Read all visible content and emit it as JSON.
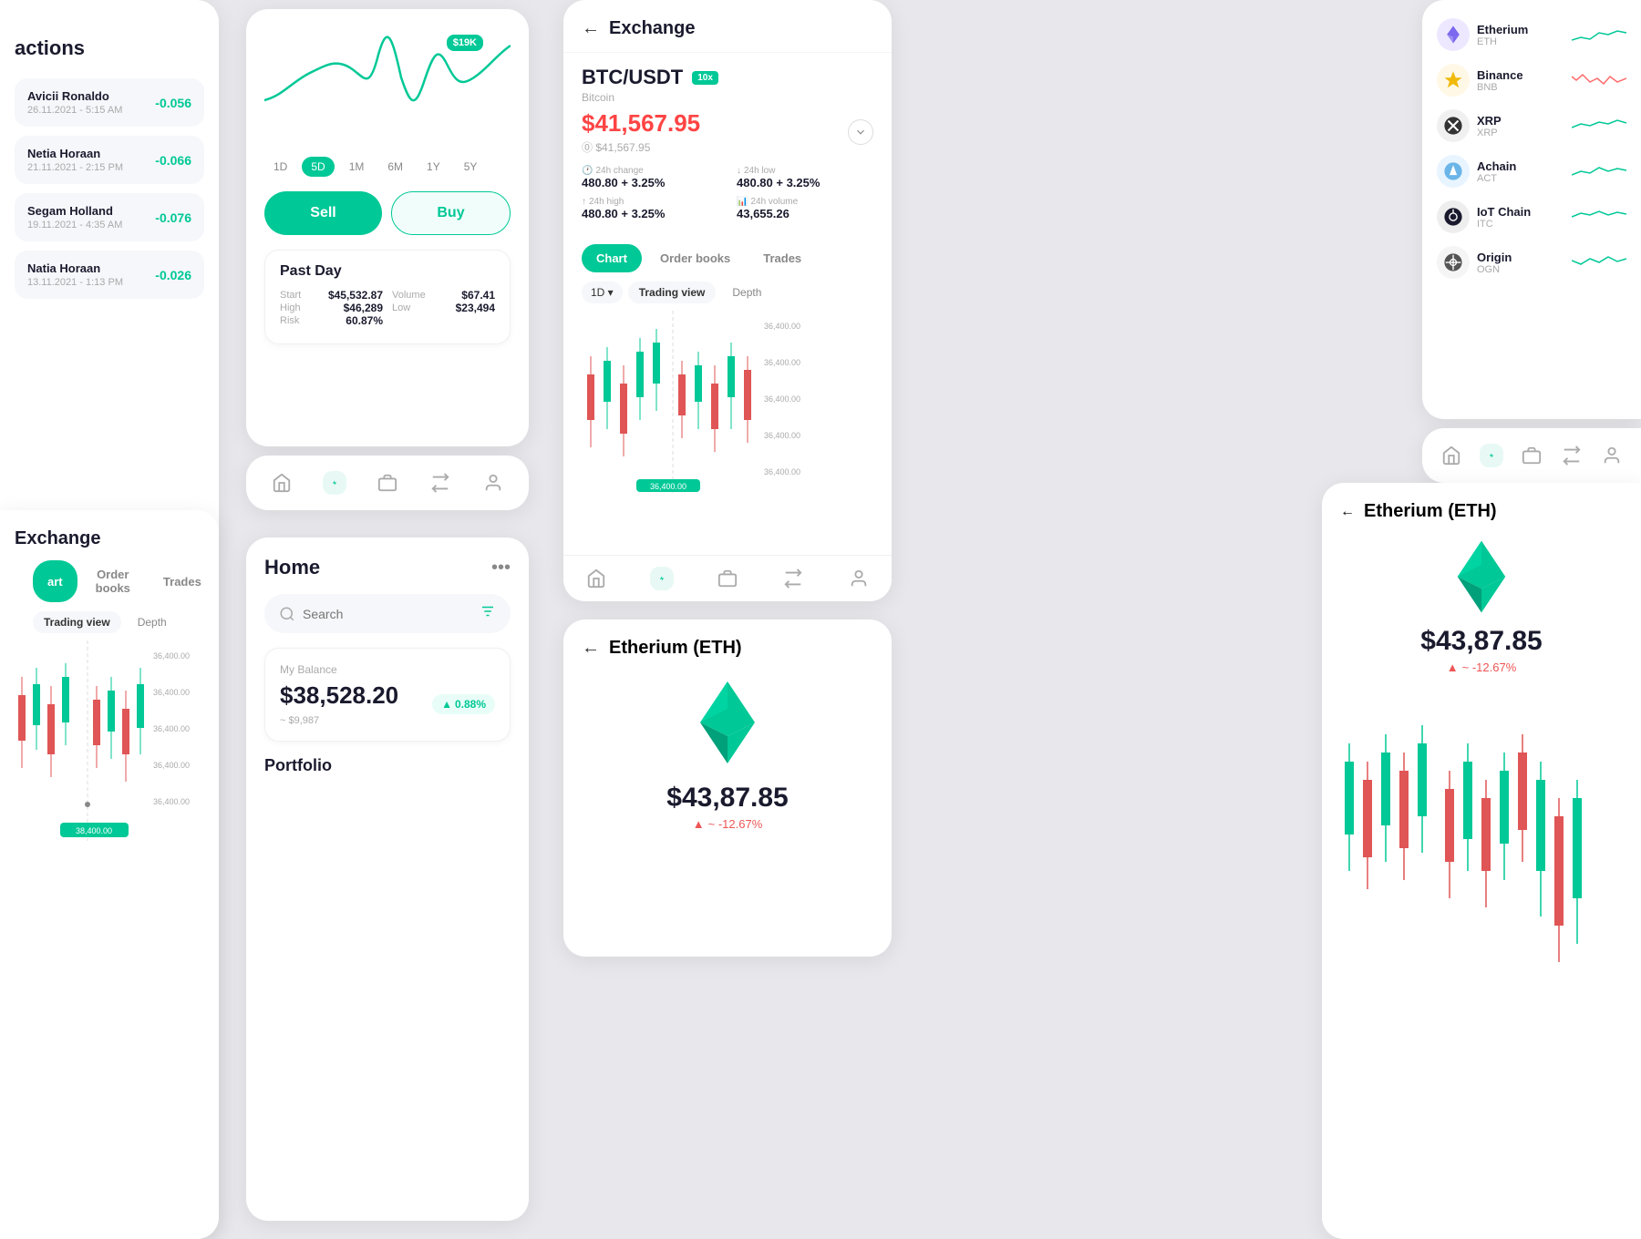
{
  "transactions": {
    "title": "actions",
    "items": [
      {
        "name": "Avicii Ronaldo",
        "date": "26.11.2021 - 5:15 AM",
        "amount": "-0.056"
      },
      {
        "name": "Netia Horaan",
        "date": "21.11.2021 - 2:15 PM",
        "amount": "-0.066"
      },
      {
        "name": "Segam Holland",
        "date": "19.11.2021 - 4:35 AM",
        "amount": "-0.076"
      },
      {
        "name": "Natia Horaan",
        "date": "13.11.2021 - 1:13 PM",
        "amount": "-0.026"
      }
    ]
  },
  "chart_panel": {
    "price_badge": "$19K",
    "time_tabs": [
      "1D",
      "5D",
      "1M",
      "6M",
      "1Y",
      "5Y"
    ],
    "active_tab": "5D",
    "sell_label": "Sell",
    "buy_label": "Buy",
    "past_day": {
      "title": "Past Day",
      "start_label": "Start",
      "start_val": "$45,532.87",
      "volume_label": "Volume",
      "volume_val": "$67.41",
      "high_label": "High",
      "high_val": "$46,289",
      "low_label": "Low",
      "low_val": "$23,494",
      "risk_label": "Risk",
      "risk_val": "60.87%"
    }
  },
  "exchange": {
    "title": "Exchange",
    "pair": "BTC/USDT",
    "leverage": "10x",
    "coin": "Bitcoin",
    "price": "$41,567.95",
    "price_usd": "⓪ $41,567.95",
    "change_24h_label": "24h change",
    "change_24h_val": "480.80 + 3.25%",
    "low_24h_label": "24h low",
    "low_24h_val": "480.80 + 3.25%",
    "high_24h_label": "24h high",
    "high_24h_val": "480.80 + 3.25%",
    "volume_24h_label": "24h volume",
    "volume_24h_val": "43,655.26",
    "tabs": [
      "Chart",
      "Order books",
      "Trades"
    ],
    "active_tab": "Chart",
    "view_period": "1D",
    "view_modes": [
      "Trading view",
      "Depth"
    ],
    "active_view": "Trading view",
    "y_labels": [
      "36,400.00",
      "36,400.00",
      "36,400.00",
      "36,400.00",
      "36,400.00"
    ]
  },
  "crypto_list": {
    "items": [
      {
        "name": "Etherium",
        "sym": "ETH",
        "icon_color": "#7B68EE",
        "icon_char": "◆"
      },
      {
        "name": "Binance",
        "sym": "BNB",
        "icon_color": "#F0B90B",
        "icon_char": "◈"
      },
      {
        "name": "XRP",
        "sym": "XRP",
        "icon_color": "#333",
        "icon_char": "✕"
      },
      {
        "name": "Achain",
        "sym": "ACT",
        "icon_color": "#6BB5E8",
        "icon_char": "▲"
      },
      {
        "name": "IoT Chain",
        "sym": "ITC",
        "icon_color": "#1a1a2e",
        "icon_char": "⬡"
      },
      {
        "name": "Origin",
        "sym": "OGN",
        "icon_color": "#555",
        "icon_char": "⊘"
      }
    ]
  },
  "home": {
    "title": "Home",
    "search_placeholder": "Search",
    "balance_label": "My Balance",
    "balance_amount": "$38,528.20",
    "balance_change": "~ $9,987",
    "badge_text": "0.88%",
    "portfolio_title": "Portfolio"
  },
  "exchange_left": {
    "title": "Exchange",
    "tabs": [
      "art",
      "Order books",
      "Trades"
    ],
    "view_modes": [
      "Trading view",
      "Depth"
    ],
    "y_labels": [
      "36,400.00",
      "36,400.00",
      "36,400.00",
      "36,400.00",
      "36,400.00"
    ]
  },
  "eth_center": {
    "title": "Etherium (ETH)",
    "price": "$43,87.85",
    "change": "~ -12.67%"
  },
  "eth_right": {
    "title": "Etherium (ETH)",
    "price": "$43,87.85",
    "change": "~ -12.67%"
  },
  "colors": {
    "primary": "#00c896",
    "danger": "#ff4444",
    "bg": "#e8e8ec"
  }
}
